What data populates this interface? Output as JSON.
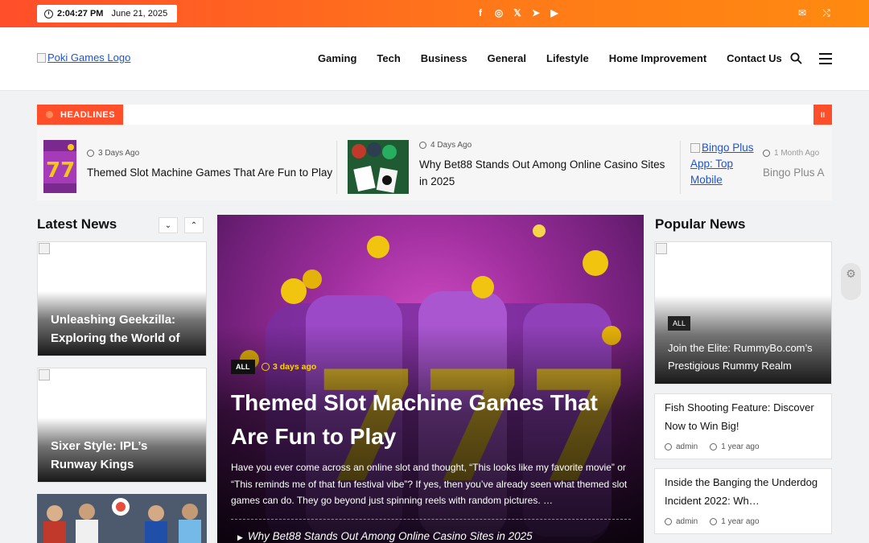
{
  "topbar": {
    "time": "2:04:27 PM",
    "date": "June 21, 2025",
    "social": [
      "f",
      "◎",
      "𝕏",
      "➤",
      "▶"
    ],
    "right_icons": [
      "✉",
      "⤭"
    ]
  },
  "header": {
    "logo_alt": "Poki Games Logo",
    "nav": [
      "Gaming",
      "Tech",
      "Business",
      "General",
      "Lifestyle",
      "Home Improvement",
      "Contact Us"
    ]
  },
  "ticker": {
    "label": "HEADLINES",
    "pause": "II",
    "items": [
      {
        "meta": "3 Days Ago",
        "title": "Themed Slot Machine Games That Are Fun to Play"
      },
      {
        "meta": "4 Days Ago",
        "title_line1": "Why Bet88 Stands Out Among Online Casino Sites",
        "title_line2": "in 2025"
      },
      {
        "img_alt1": "Bingo Plus",
        "img_alt2": "App: Top",
        "img_alt3": "Mobile",
        "meta": "1 Month Ago",
        "title": "Bingo Plus A"
      }
    ]
  },
  "latest": {
    "title": "Latest News",
    "down": "⌄",
    "up": "⌃",
    "cards": [
      {
        "title": "Unleashing Geekzilla: Exploring the World of …"
      },
      {
        "title": "Sixer Style: IPL’s Runway Kings"
      }
    ]
  },
  "hero": {
    "badge": "ALL",
    "date": "3 days ago",
    "title": "Themed Slot Machine Games That Are Fun to Play",
    "excerpt": "Have you ever come across an online slot and thought, “This looks like my favorite movie” or “This reminds me of that fun festival vibe”? If yes, then you’ve already seen what themed slot games can do. They go beyond just spinning reels with random pictures. …",
    "related": "Why Bet88 Stands Out Among Online Casino Sites in 2025"
  },
  "popular": {
    "title": "Popular News",
    "featured": {
      "badge": "ALL",
      "title": "Join the Elite: RummyBo.com’s Prestigious Rummy Realm"
    },
    "items": [
      {
        "title": "Fish Shooting Feature: Discover Now to Win Big!",
        "author": "admin",
        "time": "1 year ago"
      },
      {
        "title": "Inside the Banging the Underdog Incident 2022: Wh…",
        "author": "admin",
        "time": "1 year ago"
      }
    ]
  },
  "colors": {
    "accent": "#ff4e2a",
    "date_highlight": "#ffd400"
  }
}
